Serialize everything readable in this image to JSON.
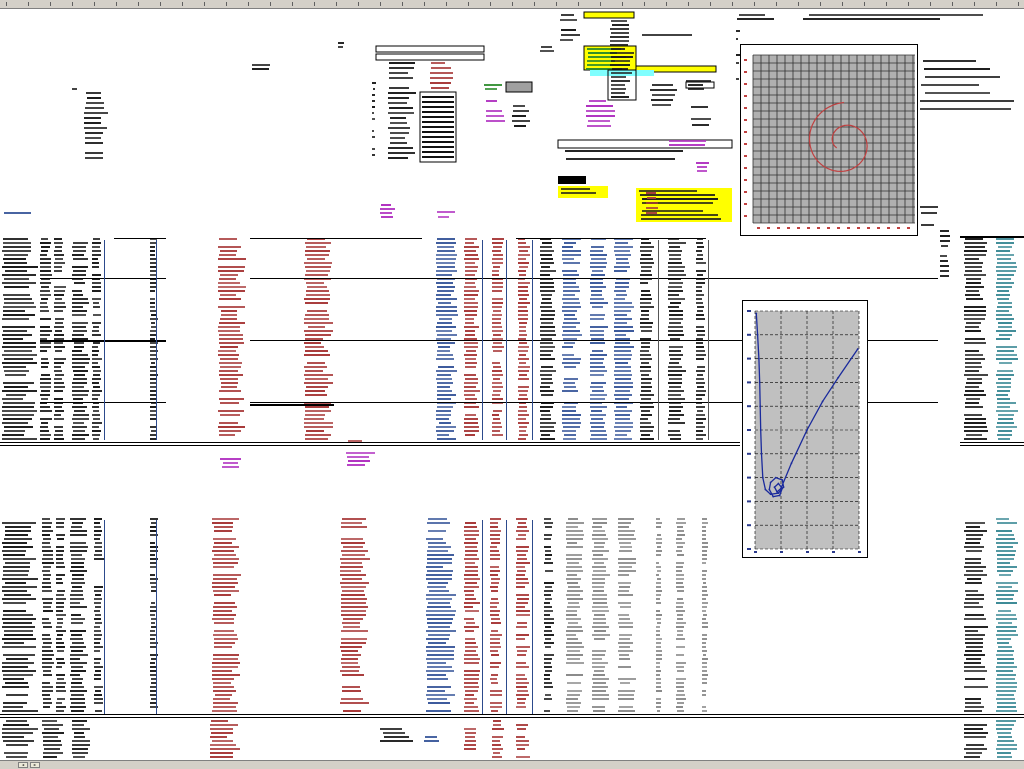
{
  "window": {
    "bottom_buttons": [
      "◄",
      "►"
    ]
  },
  "colors": {
    "ink": "#1a1a1a",
    "red": "#a83a3a",
    "blue": "#3c5a9c",
    "teal": "#3c8a96",
    "magenta": "#b030c0",
    "green": "#2a8a2a",
    "yellow": "#ffff00",
    "cyan": "#80ffff",
    "grid_gray": "#c0c0c0",
    "spiral_red": "#c04040",
    "spiral_blue": "#1a2a9c"
  },
  "chart_data": [
    {
      "type": "line",
      "title": "",
      "xlabel": "",
      "ylabel": "",
      "grid": true,
      "background": "grid",
      "series": [
        {
          "curve": "spiral",
          "center": [
            0.5,
            0.45
          ],
          "turns": 1.35,
          "r_start": 0.1,
          "r_end": 0.45,
          "color": "#c04040"
        }
      ]
    },
    {
      "type": "line",
      "title": "",
      "xlabel": "",
      "ylabel": "",
      "grid": true,
      "xlim": [
        0,
        4
      ],
      "ylim": [
        0,
        10
      ],
      "series": [
        {
          "points": [
            [
              0.05,
              9.9
            ],
            [
              0.1,
              9.0
            ],
            [
              0.15,
              8.0
            ],
            [
              0.18,
              7.0
            ],
            [
              0.2,
              6.0
            ],
            [
              0.22,
              5.0
            ],
            [
              0.25,
              4.0
            ],
            [
              0.3,
              3.0
            ],
            [
              0.4,
              2.5
            ],
            [
              0.6,
              2.3
            ],
            [
              0.9,
              2.35
            ],
            [
              1.1,
              2.6
            ],
            [
              1.05,
              2.9
            ],
            [
              0.8,
              3.0
            ],
            [
              0.6,
              2.8
            ],
            [
              0.55,
              2.5
            ],
            [
              0.7,
              2.2
            ],
            [
              0.95,
              2.25
            ],
            [
              1.05,
              2.55
            ],
            [
              0.9,
              2.75
            ],
            [
              0.75,
              2.6
            ],
            [
              0.85,
              2.4
            ],
            [
              1.0,
              2.55
            ],
            [
              1.4,
              3.6
            ],
            [
              2.0,
              5.0
            ],
            [
              2.6,
              6.2
            ],
            [
              3.2,
              7.2
            ],
            [
              3.95,
              8.4
            ]
          ],
          "color": "#1a2a9c"
        }
      ]
    }
  ]
}
